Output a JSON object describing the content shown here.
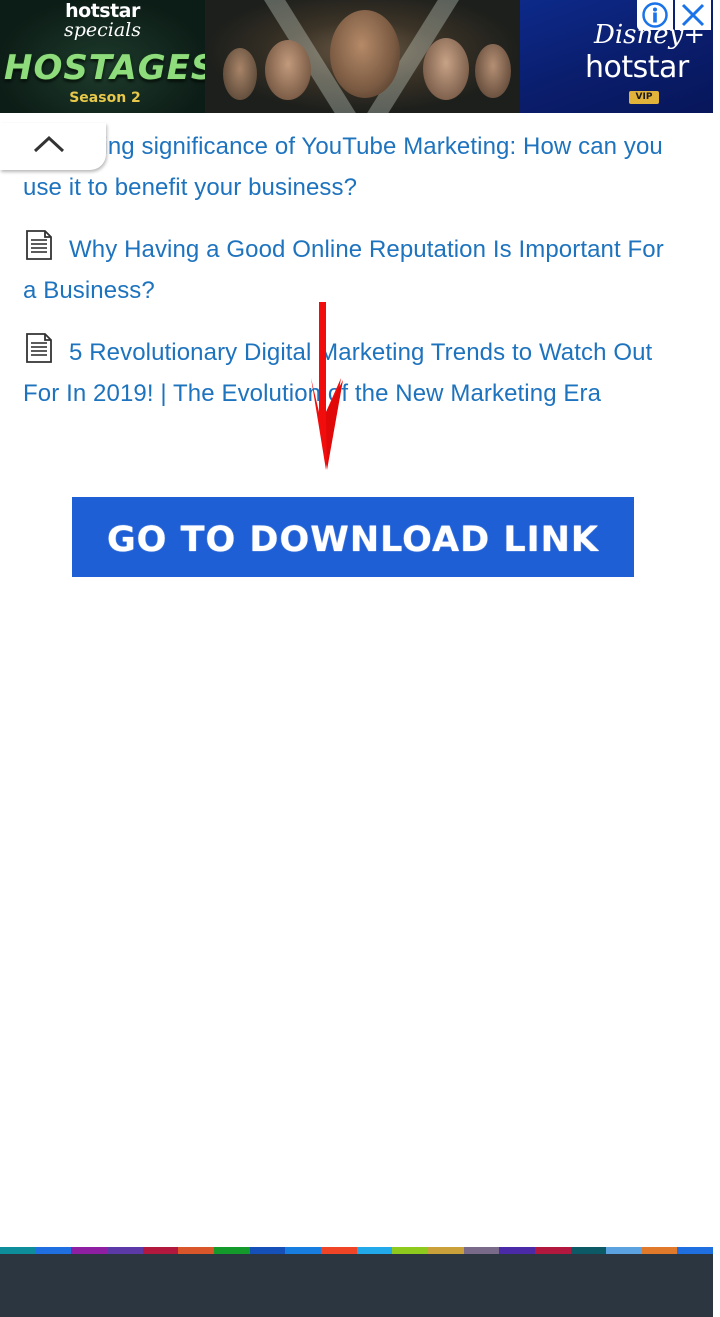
{
  "ad": {
    "brand_top": "hotstar",
    "brand_specials": "specials",
    "show_title": "HOSTAGES",
    "season": "Season 2",
    "disney": "Disney+",
    "hotstar": "hotstar",
    "vip": "VIP",
    "colors": {
      "info_icon": "#1a73e8",
      "close_icon": "#1a73e8",
      "title_green": "#8fdc7c",
      "vip_gold": "#e2b33a",
      "right_panel_blue": "#0d2a8a"
    },
    "icons": {
      "info": "info-circle-icon",
      "close": "close-x-icon"
    }
  },
  "collapse": {
    "icon": "chevron-up-icon"
  },
  "related_posts": {
    "link_color": "#1e73be",
    "items": [
      {
        "title": "Increasing significance of YouTube Marketing: How can you use it to benefit your business?",
        "icon": "document-icon"
      },
      {
        "title": "Why Having a Good Online Reputation Is Important For a Business?",
        "icon": "document-icon"
      },
      {
        "title": "5 Revolutionary Digital Marketing Trends to Watch Out For In 2019! | The Evolution of the New Marketing Era",
        "icon": "document-icon"
      }
    ]
  },
  "arrow": {
    "icon": "red-down-arrow-icon",
    "color": "#f20d0d"
  },
  "download": {
    "label": "GO TO DOWNLOAD LINK",
    "bg_color": "#1f5fd6"
  },
  "footer": {
    "bg_color": "#2b3640",
    "strip_colors": [
      "#0e8e9a",
      "#1f6fe0",
      "#8e1fa3",
      "#5b3aa8",
      "#b2183e",
      "#d9562a",
      "#149a2a",
      "#1450b8",
      "#177ee0",
      "#ef4426",
      "#21a9ea",
      "#8ec91e",
      "#c9a03a",
      "#7a6a8a",
      "#4b2aa8",
      "#b2183e",
      "#0b5a66",
      "#5aa2e0",
      "#e07a2a",
      "#1f6fe0"
    ]
  }
}
